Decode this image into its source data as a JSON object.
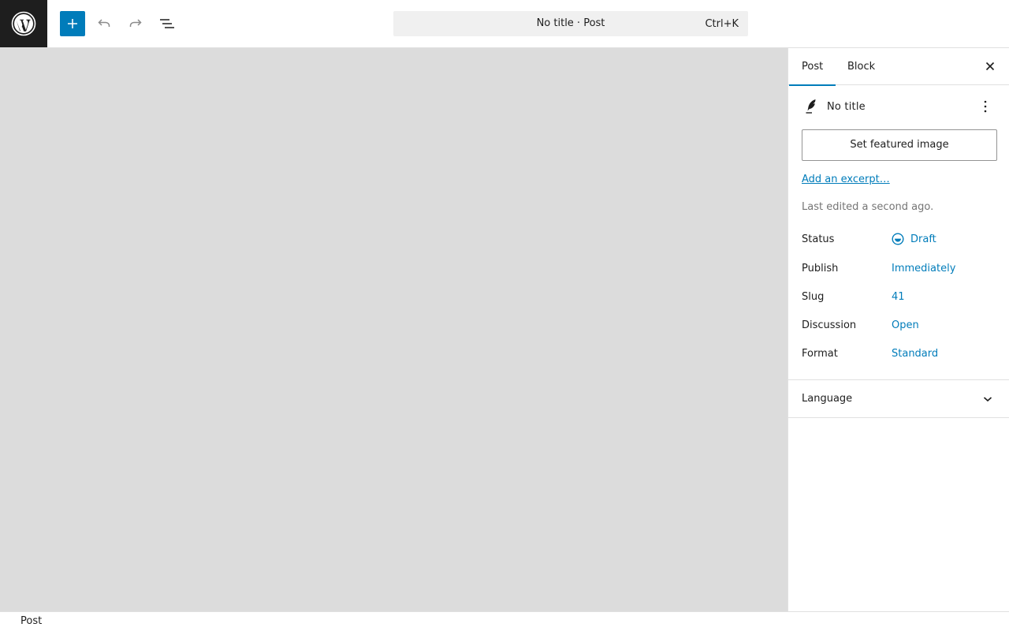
{
  "toolbar": {
    "logo_icon": "wordpress-logo-icon",
    "add_icon": "plus-icon",
    "undo_icon": "undo-icon",
    "redo_icon": "redo-icon",
    "list_view_icon": "list-view-icon",
    "command_title": "No title · Post",
    "command_shortcut": "Ctrl+K",
    "accent_color": "#007cba"
  },
  "sidebar": {
    "tabs": [
      {
        "label": "Post",
        "active": true
      },
      {
        "label": "Block",
        "active": false
      }
    ],
    "close_icon": "close-icon",
    "post_card": {
      "icon": "feather-post-icon",
      "title": "No title",
      "more_icon": "more-vertical-icon"
    },
    "featured_image_button": "Set featured image",
    "excerpt_link": "Add an excerpt…",
    "last_edited": "Last edited a second ago.",
    "meta": [
      {
        "label": "Status",
        "value": "Draft",
        "icon": "draft-status-icon"
      },
      {
        "label": "Publish",
        "value": "Immediately"
      },
      {
        "label": "Slug",
        "value": "41"
      },
      {
        "label": "Discussion",
        "value": "Open"
      },
      {
        "label": "Format",
        "value": "Standard"
      }
    ],
    "language_panel": {
      "label": "Language",
      "chevron_icon": "chevron-down-icon"
    }
  },
  "footer": {
    "breadcrumb": "Post"
  }
}
